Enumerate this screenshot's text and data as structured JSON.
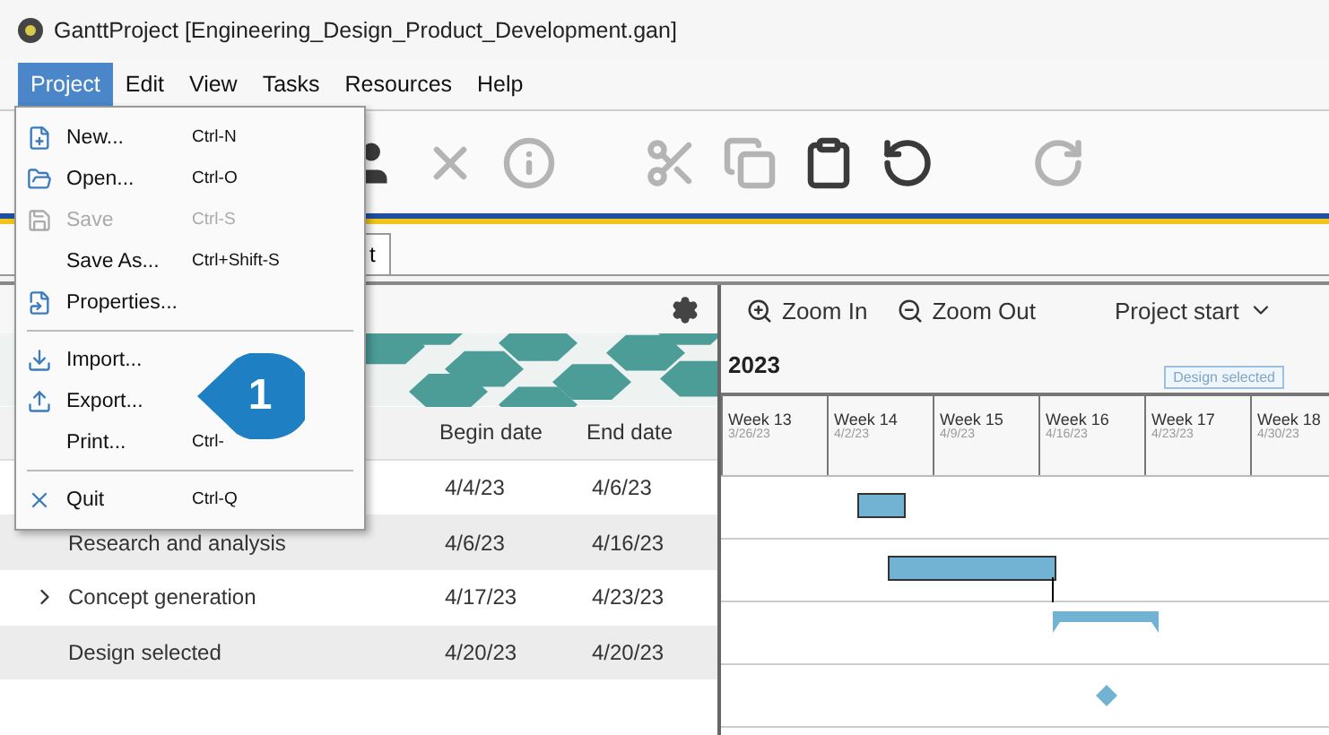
{
  "window": {
    "title": "GanttProject [Engineering_Design_Product_Development.gan]"
  },
  "menu_bar": [
    {
      "label": "Project",
      "selected": true
    },
    {
      "label": "Edit",
      "selected": false
    },
    {
      "label": "View",
      "selected": false
    },
    {
      "label": "Tasks",
      "selected": false
    },
    {
      "label": "Resources",
      "selected": false
    },
    {
      "label": "Help",
      "selected": false
    }
  ],
  "toolbar": [
    {
      "disabled": false
    },
    {
      "disabled": true
    },
    {
      "disabled": true
    },
    {
      "disabled": true
    },
    {
      "disabled": true
    },
    {
      "disabled": false
    },
    {
      "disabled": false
    },
    {
      "disabled": true
    }
  ],
  "tabs": [
    {
      "label": "t"
    }
  ],
  "task_table": {
    "columns": [
      "Begin date",
      "End date"
    ],
    "rows": [
      {
        "begin": "4/4/23",
        "end": "4/6/23",
        "kind": "task"
      },
      {
        "name": "Research and analysis",
        "begin": "4/6/23",
        "end": "4/16/23",
        "kind": "task"
      },
      {
        "name": "Concept generation",
        "begin": "4/17/23",
        "end": "4/23/23",
        "expanded": false,
        "kind": "summary"
      },
      {
        "name": "Design selected",
        "begin": "4/20/23",
        "end": "4/20/23",
        "kind": "milestone"
      }
    ]
  },
  "chart": {
    "zoom_in": "Zoom In",
    "zoom_out": "Zoom Out",
    "project_start": "Project start",
    "year": "2023",
    "milestone_label": "Design selected",
    "weeks": [
      {
        "label": "Week 13",
        "date": "3/26/23"
      },
      {
        "label": "Week 14",
        "date": "4/2/23"
      },
      {
        "label": "Week 15",
        "date": "4/9/23"
      },
      {
        "label": "Week 16",
        "date": "4/16/23"
      },
      {
        "label": "Week 17",
        "date": "4/23/23"
      },
      {
        "label": "Week 18",
        "date": "4/30/23"
      }
    ]
  },
  "project_menu": {
    "sections": [
      [
        {
          "label": "New...",
          "shortcut": "Ctrl-N",
          "disabled": false
        },
        {
          "label": "Open...",
          "shortcut": "Ctrl-O",
          "disabled": false
        },
        {
          "label": "Save",
          "shortcut": "Ctrl-S",
          "disabled": true
        },
        {
          "label": "Save As...",
          "shortcut": "Ctrl+Shift-S",
          "disabled": false
        },
        {
          "label": "Properties...",
          "disabled": false
        }
      ],
      [
        {
          "label": "Import...",
          "disabled": false
        },
        {
          "label": "Export...",
          "disabled": false
        },
        {
          "label": "Print...",
          "shortcut": "Ctrl-",
          "disabled": false
        }
      ],
      [
        {
          "label": "Quit",
          "shortcut": "Ctrl-Q",
          "disabled": false
        }
      ]
    ]
  },
  "callout": {
    "number": "1"
  }
}
